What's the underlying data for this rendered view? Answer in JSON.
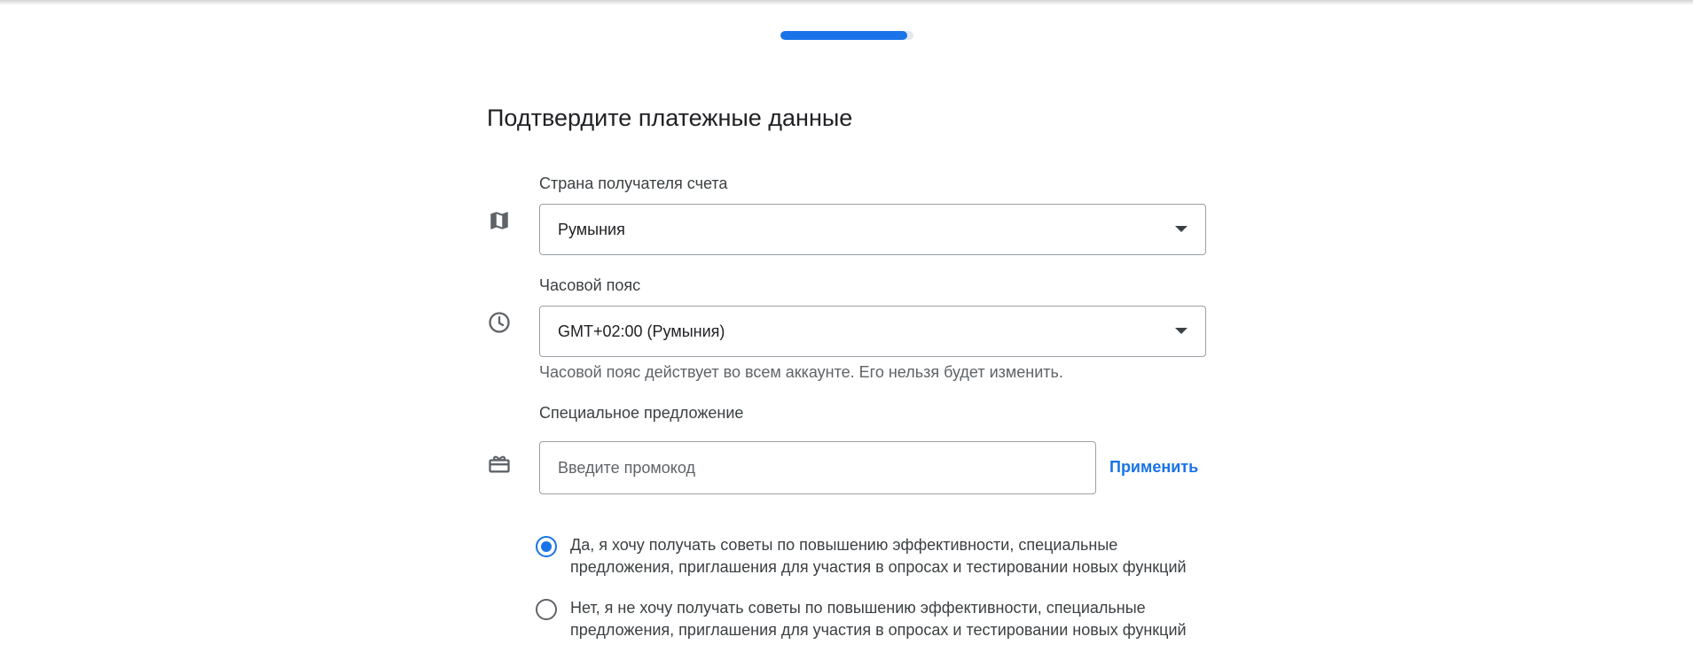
{
  "progress": {
    "fraction": 0.95
  },
  "page_title": "Подтвердите платежные данные",
  "country": {
    "label": "Страна получателя счета",
    "value": "Румыния",
    "icon": "map-icon"
  },
  "timezone": {
    "label": "Часовой пояс",
    "value": "GMT+02:00 (Румыния)",
    "helper": "Часовой пояс действует во всем аккаунте. Его нельзя будет изменить.",
    "icon": "clock-icon"
  },
  "promo": {
    "label": "Специальное предложение",
    "placeholder": "Введите промокод",
    "value": "",
    "apply_label": "Применить",
    "icon": "gift-icon"
  },
  "marketing": {
    "options": [
      {
        "text": "Да, я хочу получать советы по повышению эффективности, специальные предложения, приглашения для участия в опросах и тестировании новых функций",
        "selected": true
      },
      {
        "text": "Нет, я не хочу получать советы по повышению эффективности, специальные предложения, приглашения для участия в опросах и тестировании новых функций",
        "selected": false
      }
    ]
  },
  "colors": {
    "accent": "#1a73e8",
    "text": "#202124",
    "secondary_text": "#5f6368",
    "border": "#9aa0a6",
    "progress_track": "#e3e7ee"
  }
}
